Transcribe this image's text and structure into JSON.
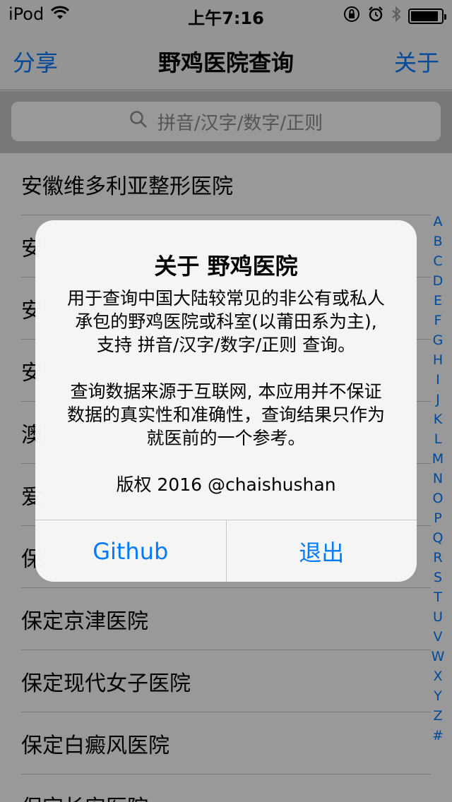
{
  "status_bar": {
    "carrier": "iPod",
    "time": "上午7:16",
    "icons": [
      "wifi-icon",
      "orientation-lock-icon",
      "alarm-icon",
      "bluetooth-icon",
      "battery-icon"
    ]
  },
  "nav": {
    "left": "分享",
    "title": "野鸡医院查询",
    "right": "关于"
  },
  "search": {
    "placeholder": "拼音/汉字/数字/正则"
  },
  "list": {
    "rows": [
      "安徽维多利亚整形医院",
      "安",
      "安",
      "安",
      "澳",
      "爱",
      "保",
      "保定京津医院",
      "保定现代女子医院",
      "保定白癜风医院",
      "保定长安医院"
    ]
  },
  "index": [
    "A",
    "B",
    "C",
    "D",
    "E",
    "F",
    "G",
    "H",
    "I",
    "J",
    "K",
    "L",
    "M",
    "N",
    "O",
    "P",
    "Q",
    "R",
    "S",
    "T",
    "U",
    "V",
    "W",
    "X",
    "Y",
    "Z",
    "#"
  ],
  "alert": {
    "title": "关于 野鸡医院",
    "lines": [
      "用于查询中国大陆较常见的非公有或私人",
      "承包的野鸡医院或科室(以莆田系为主),",
      "支持 拼音/汉字/数字/正则 查询。",
      "查询数据来源于互联网, 本应用并不保证",
      "数据的真实性和准确性，查询结果只作为",
      "就医前的一个参考。",
      "版权 2016 @chaishushan"
    ],
    "buttons": [
      "Github",
      "退出"
    ]
  },
  "colors": {
    "accent": "#007aff",
    "overlay": "rgba(0,0,0,0.4)"
  }
}
